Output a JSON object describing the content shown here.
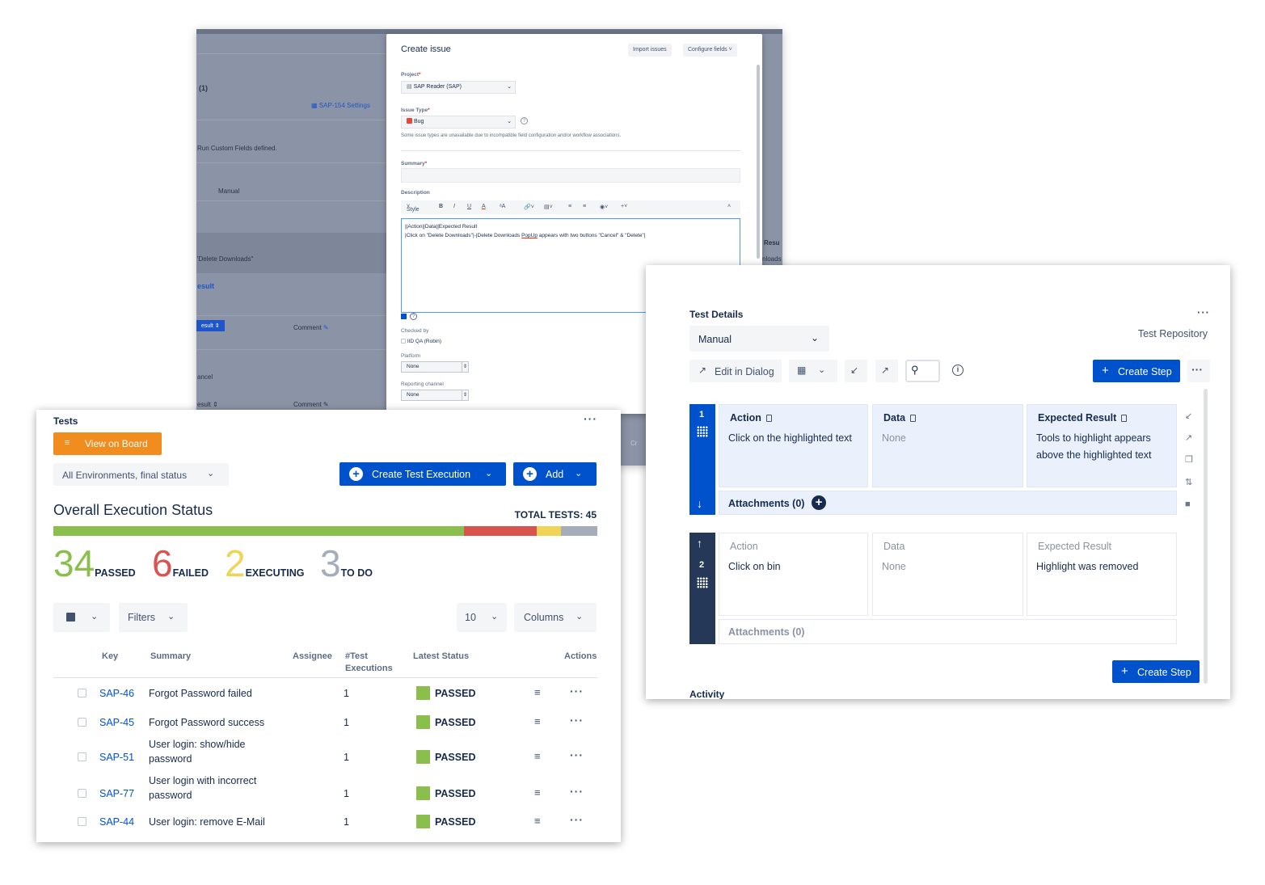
{
  "background_window": {
    "left_panel": {
      "count_label": "(1)",
      "settings_link": "SAP-154 Settings",
      "custom_fields_note": "Run Custom Fields defined.",
      "manual_label": "Manual",
      "delete_label": "'Delete Downloads\"",
      "result_label": "esult",
      "result_button": "esult",
      "comment_label": "Comment",
      "cancel_label": "ancel",
      "result_label_2": "esult",
      "comment_label_2": "Comment",
      "right_resu": "Resu",
      "right_nloads": "nloads",
      "right_cr": "Cr"
    },
    "dialog": {
      "title": "Create issue",
      "import_button": "Import issues",
      "configure_button": "Configure fields",
      "project_label": "Project",
      "project_value": "SAP Reader (SAP)",
      "issue_type_label": "Issue Type",
      "issue_type_value": "Bug",
      "issue_type_note": "Some issue types are unavailable due to incompatible field configuration and/or workflow associations.",
      "summary_label": "Summary",
      "description_label": "Description",
      "toolbar": {
        "style": "Style",
        "bold": "B",
        "italic": "I",
        "underline": "U",
        "color": "A",
        "size": "ᵃA"
      },
      "description_line_1": "||Action||Data||Expected Result",
      "description_line_2_prefix": "|Click on \"Delete Downloads\"|-|Delete Downloads ",
      "description_line_2_underlined": "PopUp",
      "description_line_2_suffix": " appears with two buttons \"Cancel\" & \"Delete\"|",
      "checked_by_label": "Checked by",
      "checked_by_value": "IID QA (Robin)",
      "platform_label": "Platform",
      "platform_value": "None",
      "reporting_label": "Reporting channel",
      "reporting_value": "None"
    }
  },
  "tests_card": {
    "title": "Tests",
    "view_on_board": "View on Board",
    "environment_filter": "All Environments, final status",
    "create_test_execution": "Create Test Execution",
    "add_button": "Add",
    "section_title": "Overall Execution Status",
    "total_tests": "TOTAL TESTS: 45",
    "status_segments": [
      {
        "name": "PASSED",
        "count": 34,
        "color": "#8bbf4d"
      },
      {
        "name": "FAILED",
        "count": 6,
        "color": "#d9534f"
      },
      {
        "name": "EXECUTING",
        "count": 2,
        "color": "#f0d457"
      },
      {
        "name": "TO DO",
        "count": 3,
        "color": "#a5adba"
      }
    ],
    "counts": {
      "passed_num": "34",
      "passed_word": "PASSED",
      "failed_num": "6",
      "failed_word": "FAILED",
      "executing_num": "2",
      "executing_word": "EXECUTING",
      "todo_num": "3",
      "todo_word": "TO DO"
    },
    "filters_label": "Filters",
    "page_size": "10",
    "columns_label": "Columns",
    "headers": {
      "key": "Key",
      "summary": "Summary",
      "assignee": "Assignee",
      "executions_1": "#Test",
      "executions_2": "Executions",
      "latest_status": "Latest Status",
      "actions": "Actions"
    },
    "rows": [
      {
        "key": "SAP-46",
        "summary": "Forgot Password failed",
        "executions": "1",
        "status": "PASSED"
      },
      {
        "key": "SAP-45",
        "summary": "Forgot Password success",
        "executions": "1",
        "status": "PASSED"
      },
      {
        "key": "SAP-51",
        "summary": "User login: show/hide password",
        "executions": "1",
        "status": "PASSED"
      },
      {
        "key": "SAP-77",
        "summary": "User login with incorrect password",
        "executions": "1",
        "status": "PASSED"
      },
      {
        "key": "SAP-44",
        "summary": "User login: remove E-Mail",
        "executions": "1",
        "status": "PASSED"
      }
    ]
  },
  "details_card": {
    "title": "Test Details",
    "test_type": "Manual",
    "test_repository": "Test Repository",
    "edit_in_dialog": "Edit in Dialog",
    "create_step": "Create Step",
    "steps": [
      {
        "number": "1",
        "action_header": "Action",
        "action": "Click on the highlighted text",
        "data_header": "Data",
        "data": "None",
        "expected_header": "Expected Result",
        "expected": "Tools to highlight appears above the highlighted text",
        "attachments": "Attachments (0)"
      },
      {
        "number": "2",
        "action_header": "Action",
        "action": "Click on bin",
        "data_header": "Data",
        "data": "None",
        "expected_header": "Expected Result",
        "expected": "Highlight was removed",
        "attachments": "Attachments (0)"
      }
    ],
    "create_step_bottom": "Create Step",
    "activity": "Activity"
  }
}
